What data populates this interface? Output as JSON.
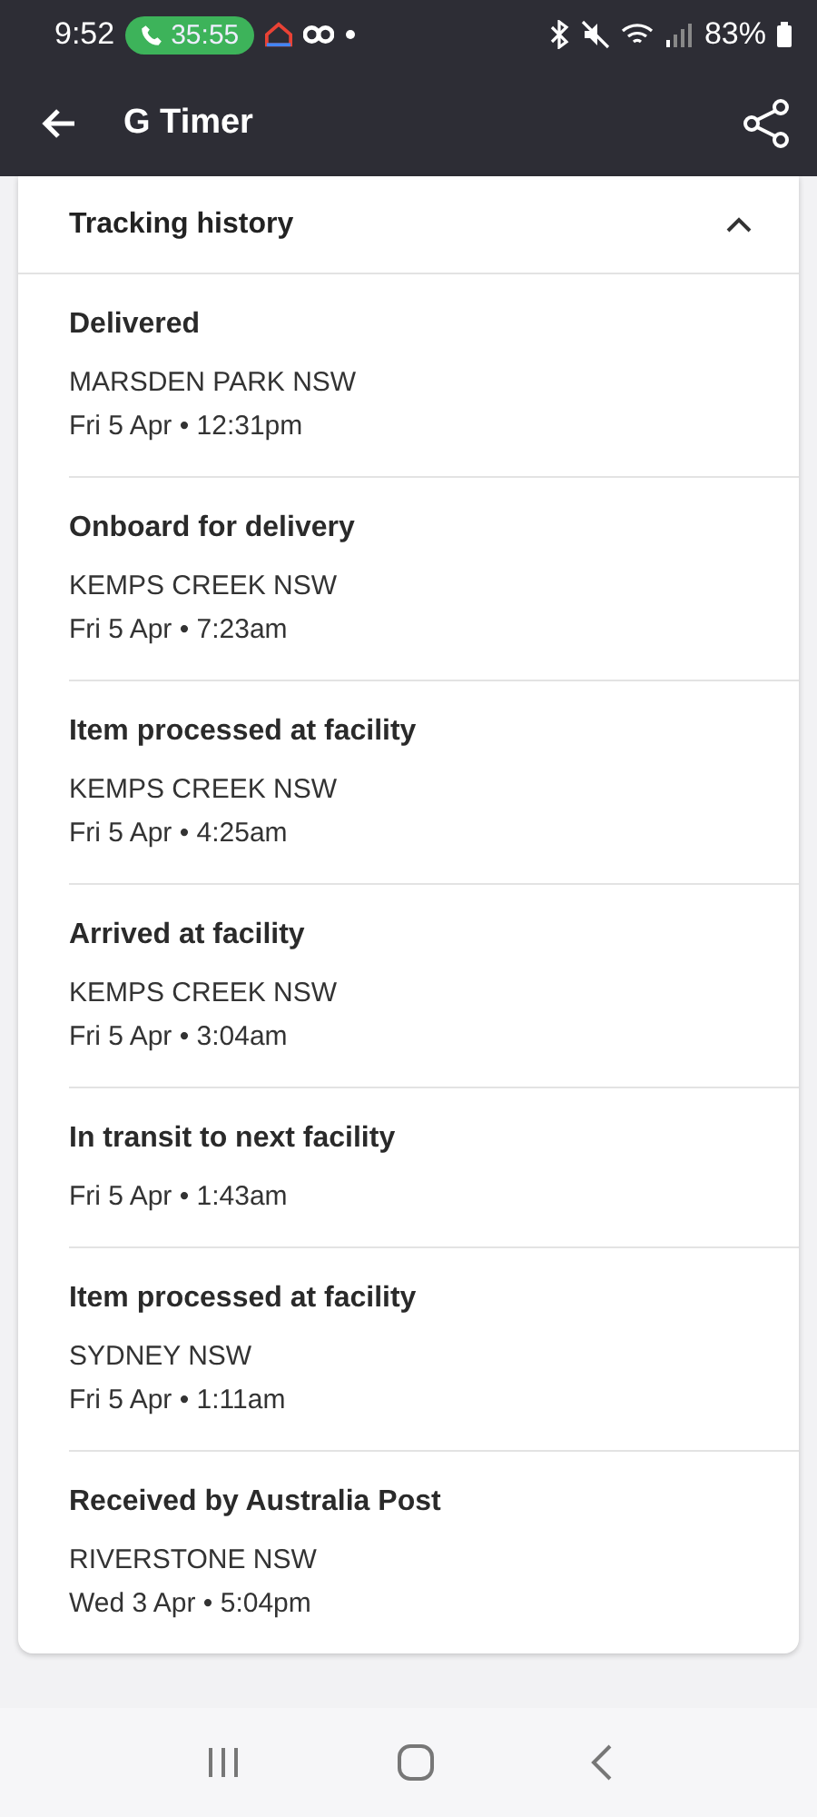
{
  "status_bar": {
    "time": "9:52",
    "call_timer": "35:55",
    "battery": "83%"
  },
  "app_bar": {
    "title": "G Timer"
  },
  "tracking_history": {
    "title": "Tracking history",
    "expanded": true,
    "events": [
      {
        "status": "Delivered",
        "location": "MARSDEN PARK NSW",
        "time": "Fri 5 Apr • 12:31pm"
      },
      {
        "status": "Onboard for delivery",
        "location": "KEMPS CREEK NSW",
        "time": "Fri 5 Apr • 7:23am"
      },
      {
        "status": "Item processed at facility",
        "location": "KEMPS CREEK NSW",
        "time": "Fri 5 Apr • 4:25am"
      },
      {
        "status": "Arrived at facility",
        "location": "KEMPS CREEK NSW",
        "time": "Fri 5 Apr • 3:04am"
      },
      {
        "status": "In transit to next facility",
        "time": "Fri 5 Apr • 1:43am"
      },
      {
        "status": "Item processed at facility",
        "location": "SYDNEY NSW",
        "time": "Fri 5 Apr • 1:11am"
      },
      {
        "status": "Received by Australia Post",
        "location": "RIVERSTONE NSW",
        "time": "Wed 3 Apr • 5:04pm"
      }
    ]
  }
}
